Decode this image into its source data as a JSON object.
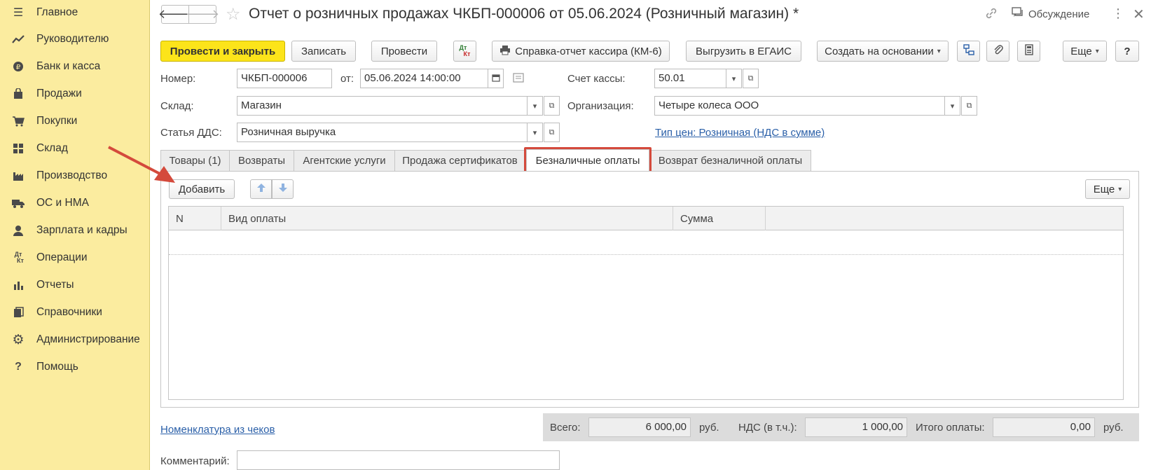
{
  "sidebar": {
    "items": [
      {
        "icon": "menu-icon",
        "label": "Главное"
      },
      {
        "icon": "trend-icon",
        "label": "Руководителю"
      },
      {
        "icon": "coin-icon",
        "label": "Банк и касса"
      },
      {
        "icon": "bag-icon",
        "label": "Продажи"
      },
      {
        "icon": "cart-icon",
        "label": "Покупки"
      },
      {
        "icon": "grid-icon",
        "label": "Склад"
      },
      {
        "icon": "factory-icon",
        "label": "Производство"
      },
      {
        "icon": "truck-icon",
        "label": "ОС и НМА"
      },
      {
        "icon": "person-icon",
        "label": "Зарплата и кадры"
      },
      {
        "icon": "dt-kt-icon",
        "label": "Операции"
      },
      {
        "icon": "bar-chart-icon",
        "label": "Отчеты"
      },
      {
        "icon": "book-icon",
        "label": "Справочники"
      },
      {
        "icon": "gear-icon",
        "label": "Администрирование"
      },
      {
        "icon": "question-icon",
        "label": "Помощь"
      }
    ]
  },
  "header": {
    "title": "Отчет о розничных продажах ЧКБП-000006 от 05.06.2024 (Розничный магазин) *",
    "discussion": "Обсуждение"
  },
  "toolbar": {
    "post_close": "Провести и закрыть",
    "save": "Записать",
    "post": "Провести",
    "dtkt_top": "Дт",
    "dtkt_bottom": "Кт",
    "cashier_report": "Справка-отчет кассира (КМ-6)",
    "egais": "Выгрузить в ЕГАИС",
    "create_based": "Создать на основании",
    "more": "Еще",
    "help": "?"
  },
  "form": {
    "number_label": "Номер:",
    "number_value": "ЧКБП-000006",
    "date_label": "от:",
    "date_value": "05.06.2024 14:00:00",
    "cash_account_label": "Счет кассы:",
    "cash_account_value": "50.01",
    "warehouse_label": "Склад:",
    "warehouse_value": "Магазин",
    "org_label": "Организация:",
    "org_value": "Четыре колеса ООО",
    "dds_label": "Статья ДДС:",
    "dds_value": "Розничная выручка",
    "price_type_link": "Тип цен: Розничная (НДС в сумме)"
  },
  "tabs": [
    {
      "label": "Товары (1)"
    },
    {
      "label": "Возвраты"
    },
    {
      "label": "Агентские услуги"
    },
    {
      "label": "Продажа сертификатов"
    },
    {
      "label": "Безналичные оплаты"
    },
    {
      "label": "Возврат безналичной оплаты"
    }
  ],
  "active_tab_index": 4,
  "panel": {
    "add_button": "Добавить",
    "more_button": "Еще",
    "columns": [
      "N",
      "Вид оплаты",
      "Сумма"
    ]
  },
  "footer": {
    "nomenclature_link": "Номенклатура из чеков",
    "total_label": "Всего:",
    "total_value": "6 000,00",
    "currency1": "руб.",
    "vat_label": "НДС (в т.ч.):",
    "vat_value": "1 000,00",
    "payment_label": "Итого оплаты:",
    "payment_value": "0,00",
    "currency2": "руб.",
    "comment_label": "Комментарий:",
    "comment_value": ""
  },
  "colors": {
    "sidebar_bg": "#fbec9f",
    "primary_button": "#fce41a",
    "highlight_red": "#d44a3c",
    "link_blue": "#2a5fa8"
  }
}
